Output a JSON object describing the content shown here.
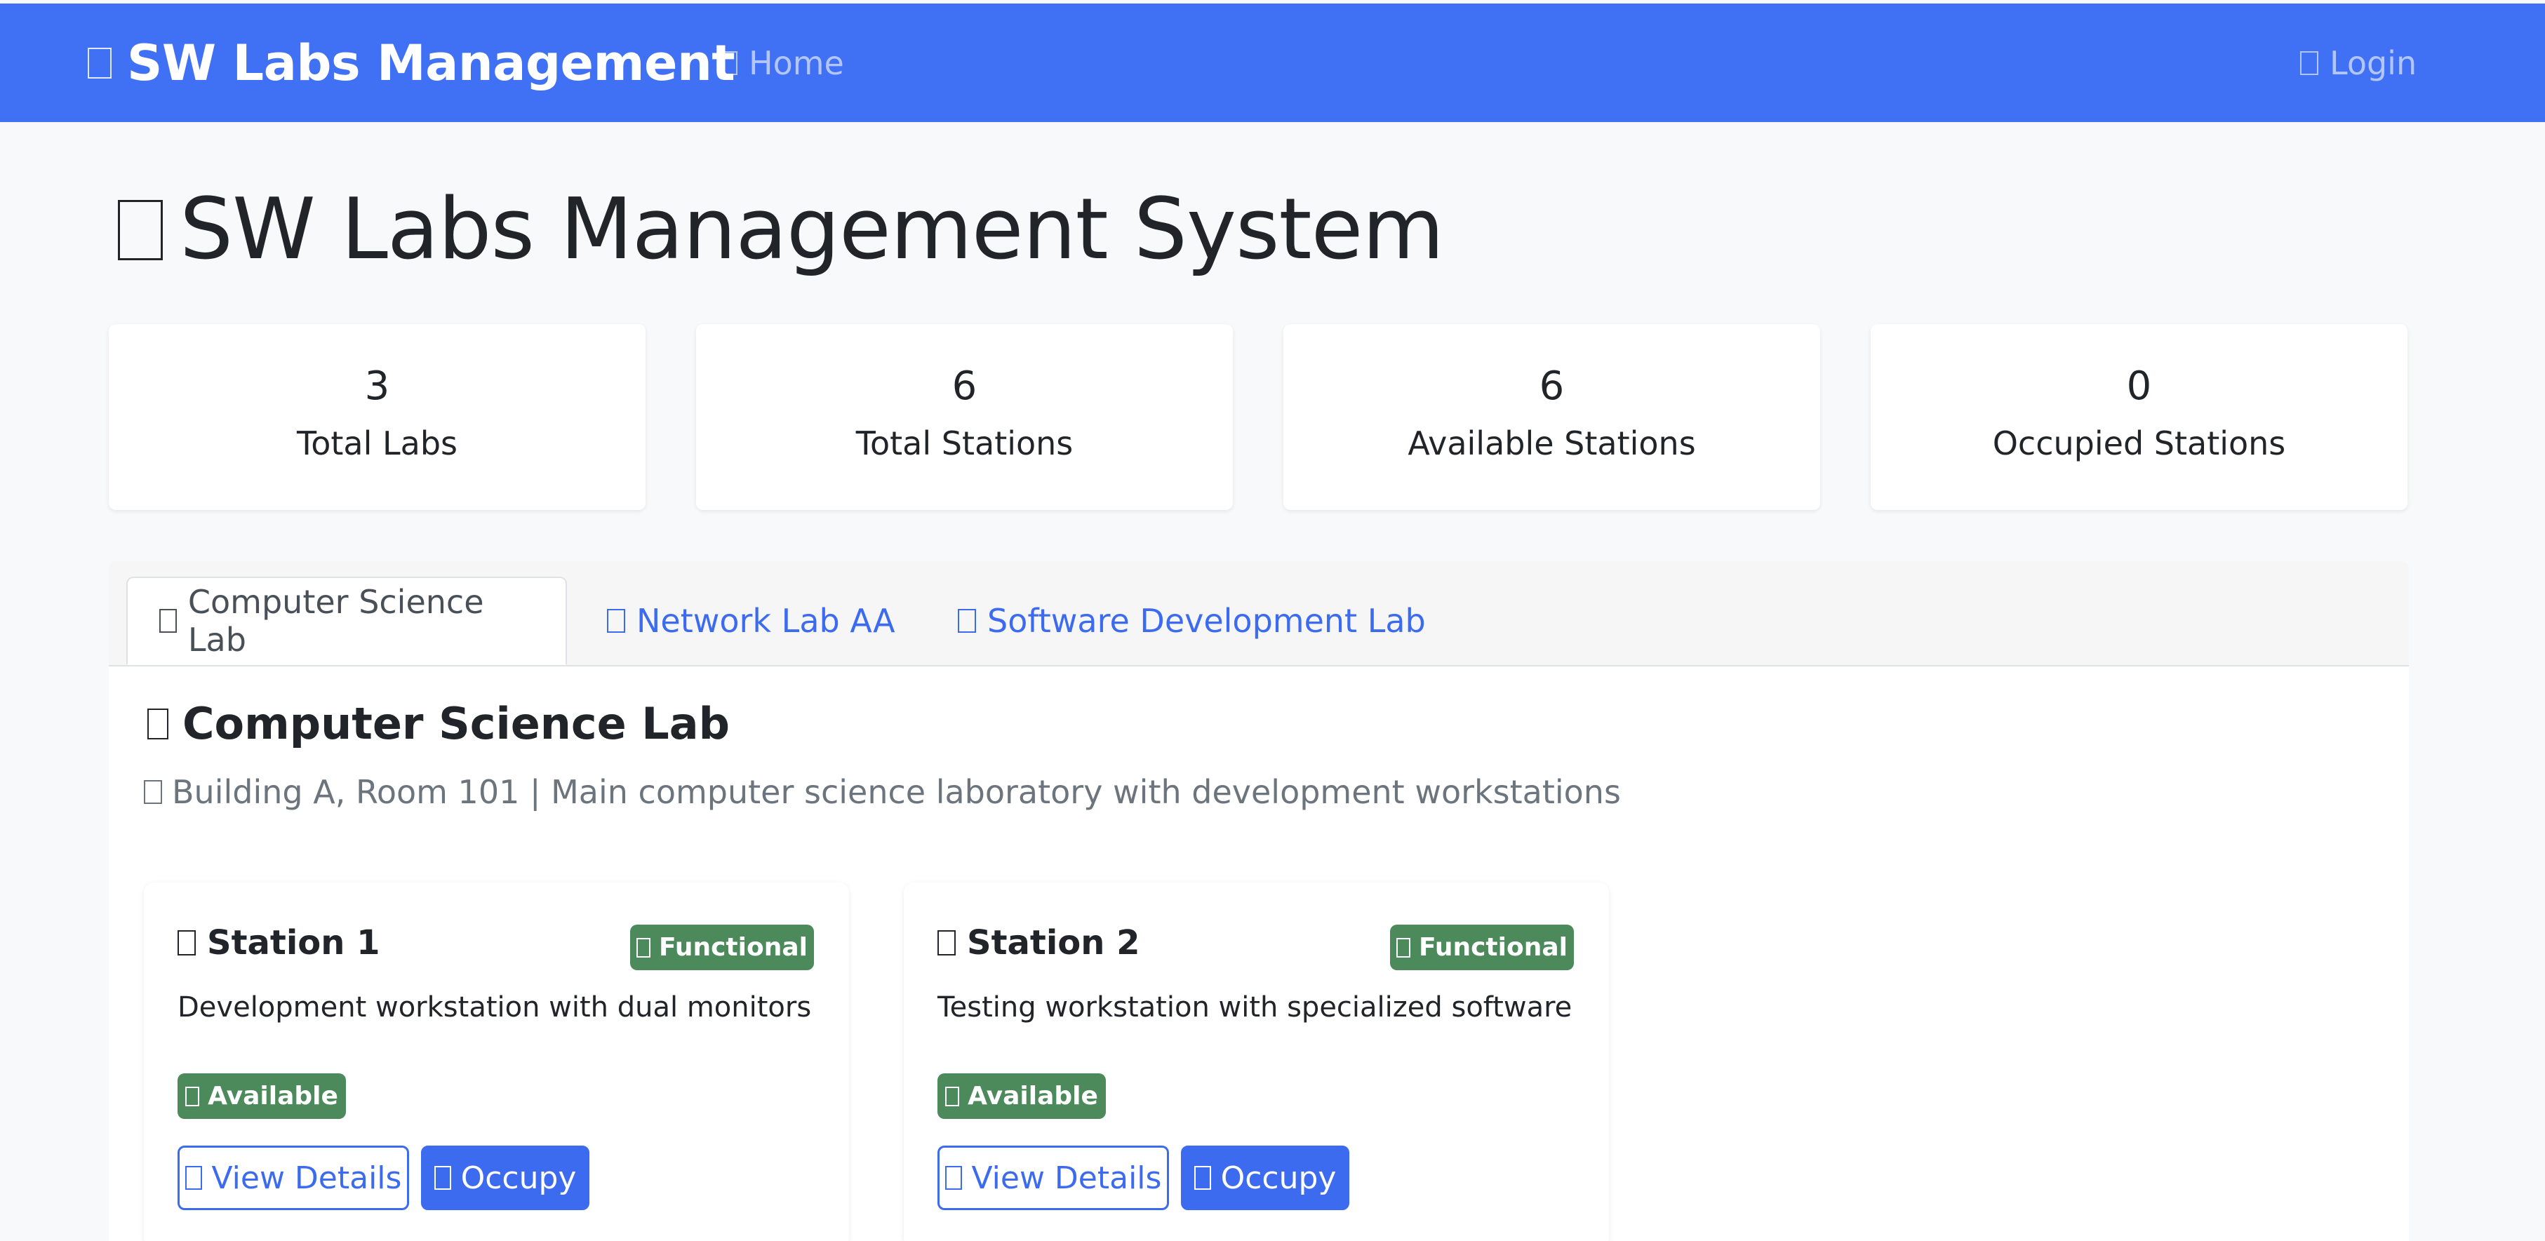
{
  "navbar": {
    "brand": "SW Labs Management",
    "brand_icon": "flask-icon",
    "home_label": "Home",
    "home_icon": "home-icon",
    "login_label": "Login",
    "login_icon": "login-icon",
    "color": "#4070f4"
  },
  "page_title": "SW Labs Management System",
  "page_title_icon": "lab-icon",
  "stats": [
    {
      "value": "3",
      "label": "Total Labs"
    },
    {
      "value": "6",
      "label": "Total Stations"
    },
    {
      "value": "6",
      "label": "Available Stations"
    },
    {
      "value": "0",
      "label": "Occupied Stations"
    }
  ],
  "tabs": [
    {
      "label": "Computer Science Lab",
      "active": true,
      "icon": "lab-icon"
    },
    {
      "label": "Network Lab AA",
      "active": false,
      "icon": "lab-icon"
    },
    {
      "label": "Software Development Lab",
      "active": false,
      "icon": "lab-icon"
    }
  ],
  "lab": {
    "name": "Computer Science Lab",
    "name_icon": "lab-icon",
    "description": "Building A, Room 101 | Main computer science laboratory with development workstations",
    "description_icon": "location-icon"
  },
  "stations": [
    {
      "name": "Station 1",
      "condition": "Functional",
      "description": "Development workstation with dual monitors",
      "status": "Available",
      "view_label": "View Details",
      "occupy_label": "Occupy"
    },
    {
      "name": "Station 2",
      "condition": "Functional",
      "description": "Testing workstation with specialized software",
      "status": "Available",
      "view_label": "View Details",
      "occupy_label": "Occupy"
    }
  ],
  "colors": {
    "primary": "#3d6bf0",
    "success": "#4c8a5b",
    "muted": "#6c757d"
  }
}
